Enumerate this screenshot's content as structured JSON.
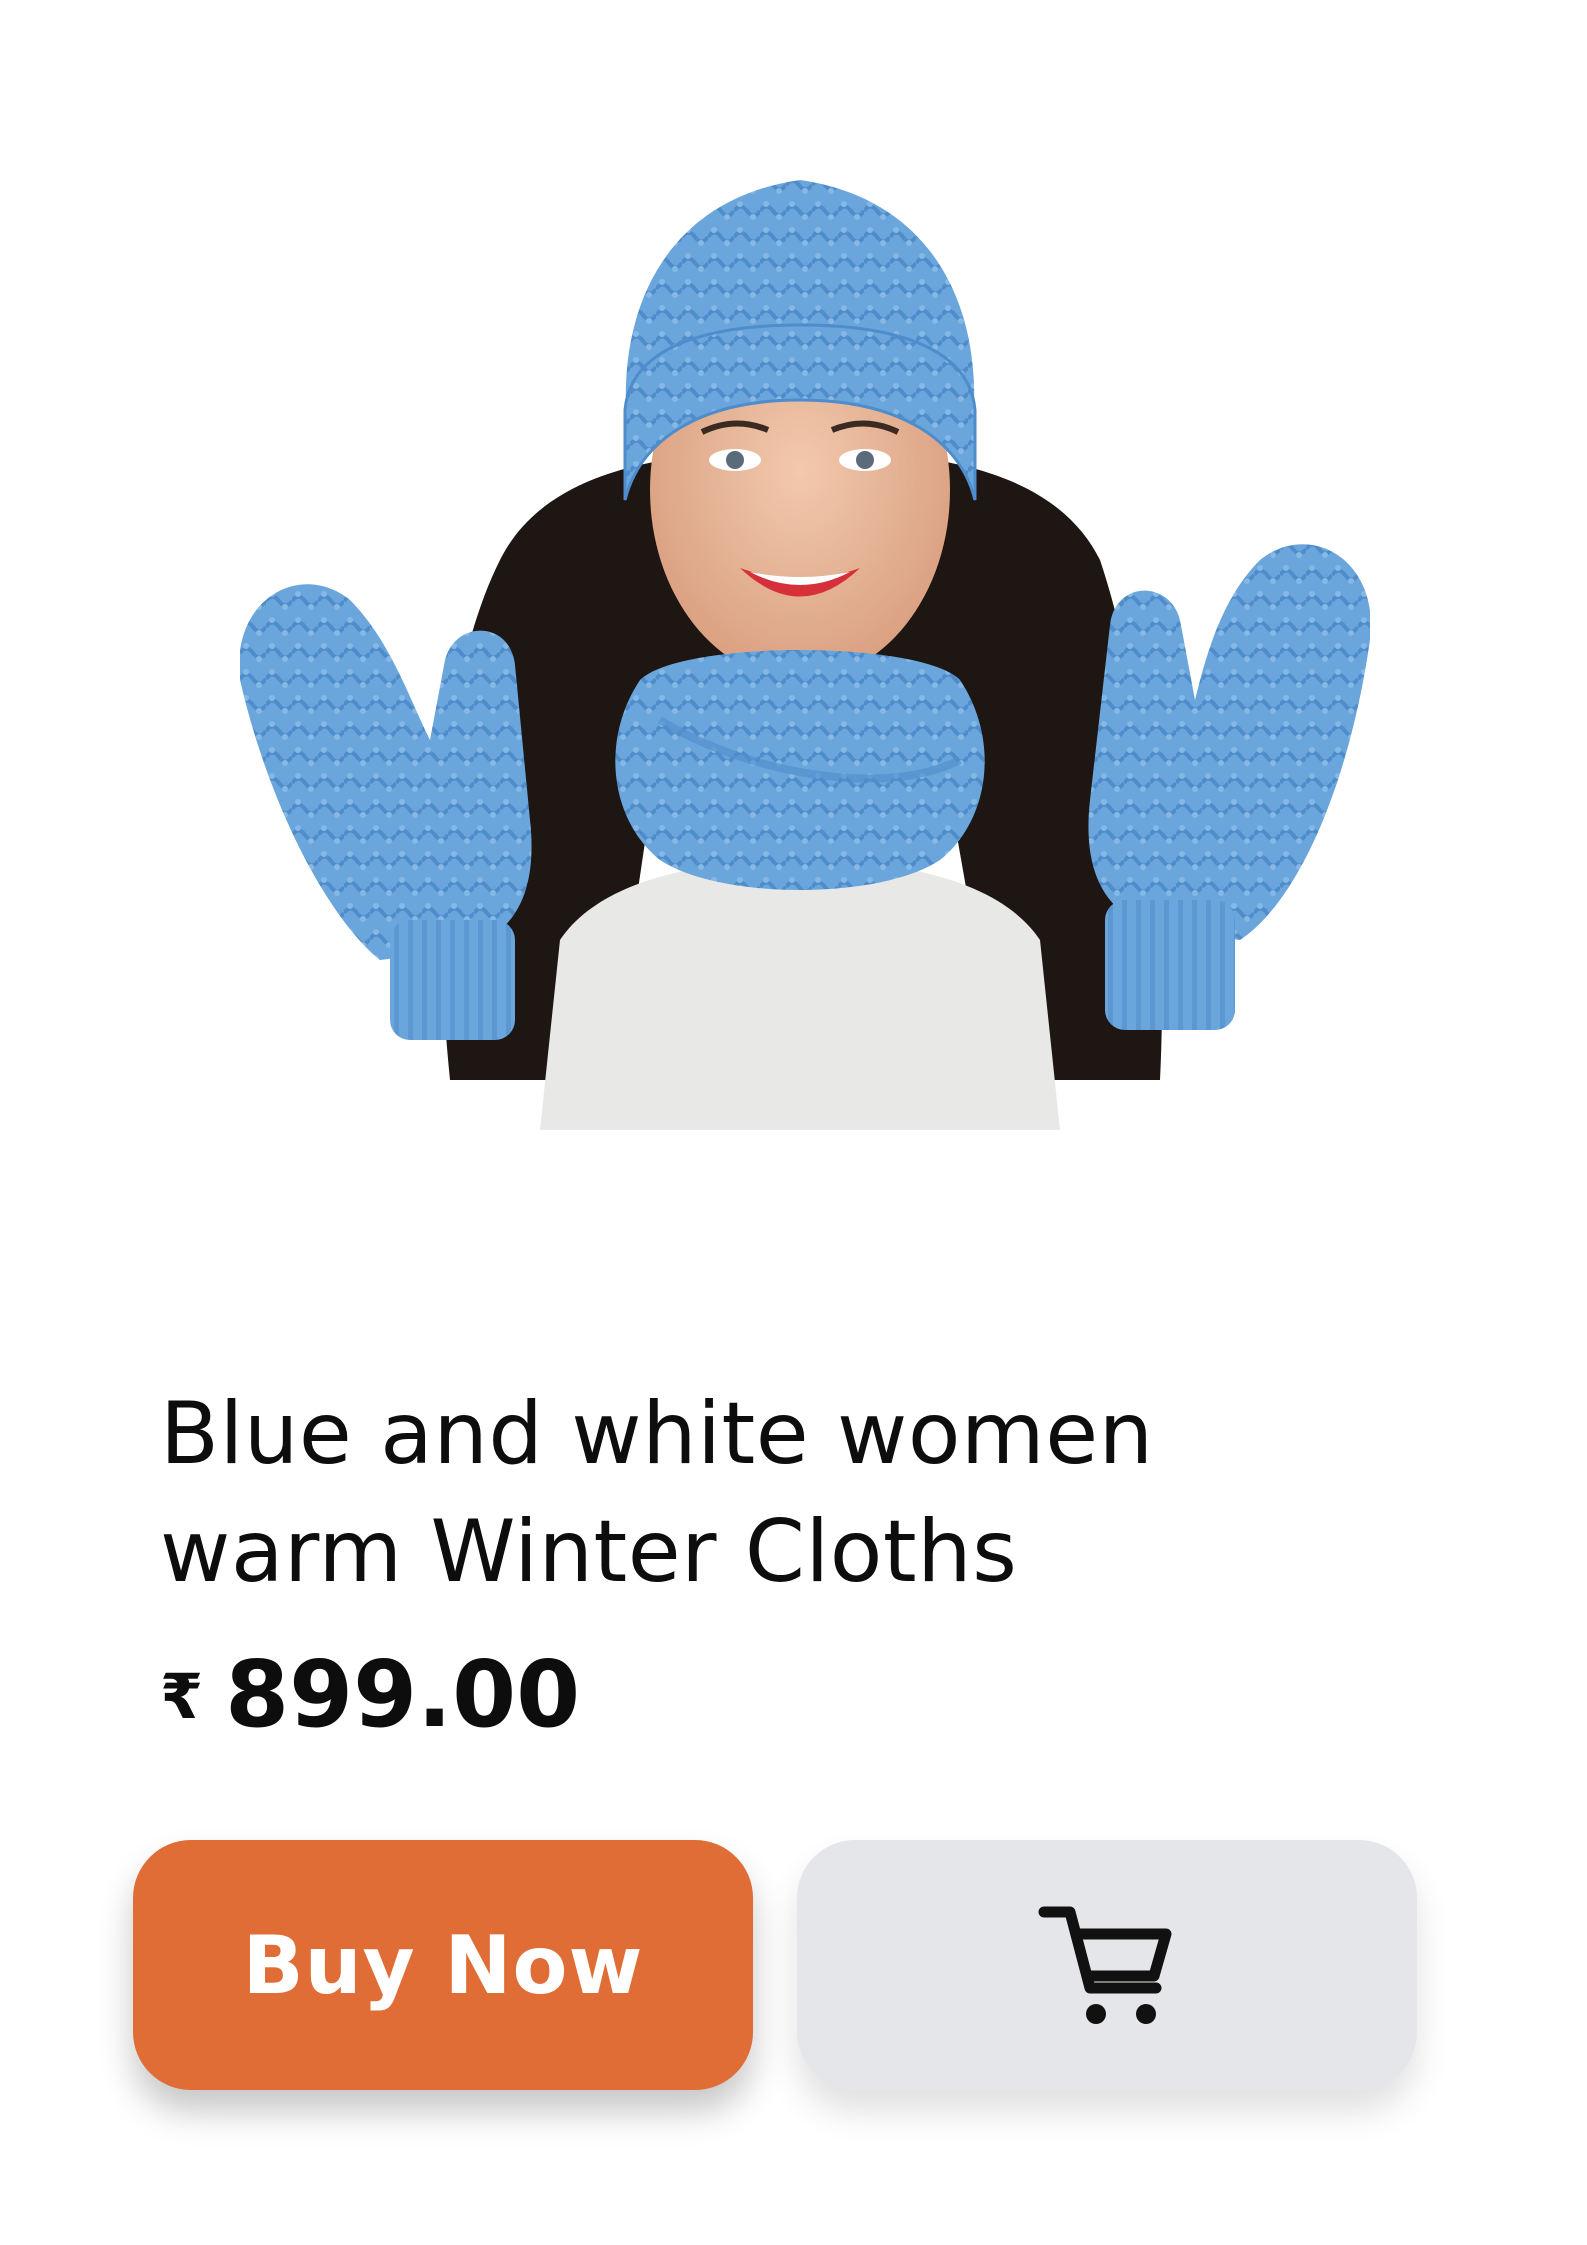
{
  "product": {
    "image_alt": "Woman wearing blue knitted hat, scarf and mittens",
    "title_line1": "Blue and white women",
    "title_line2": "warm Winter Cloths",
    "currency_symbol": "₹",
    "price": "899.00"
  },
  "actions": {
    "buy_label": "Buy Now",
    "cart_icon": "shopping-cart-icon"
  },
  "colors": {
    "buy_button": "#e06d35",
    "cart_button": "#e5e6e9",
    "knit_blue": "#6aa6dc",
    "text": "#0d0d0d"
  }
}
